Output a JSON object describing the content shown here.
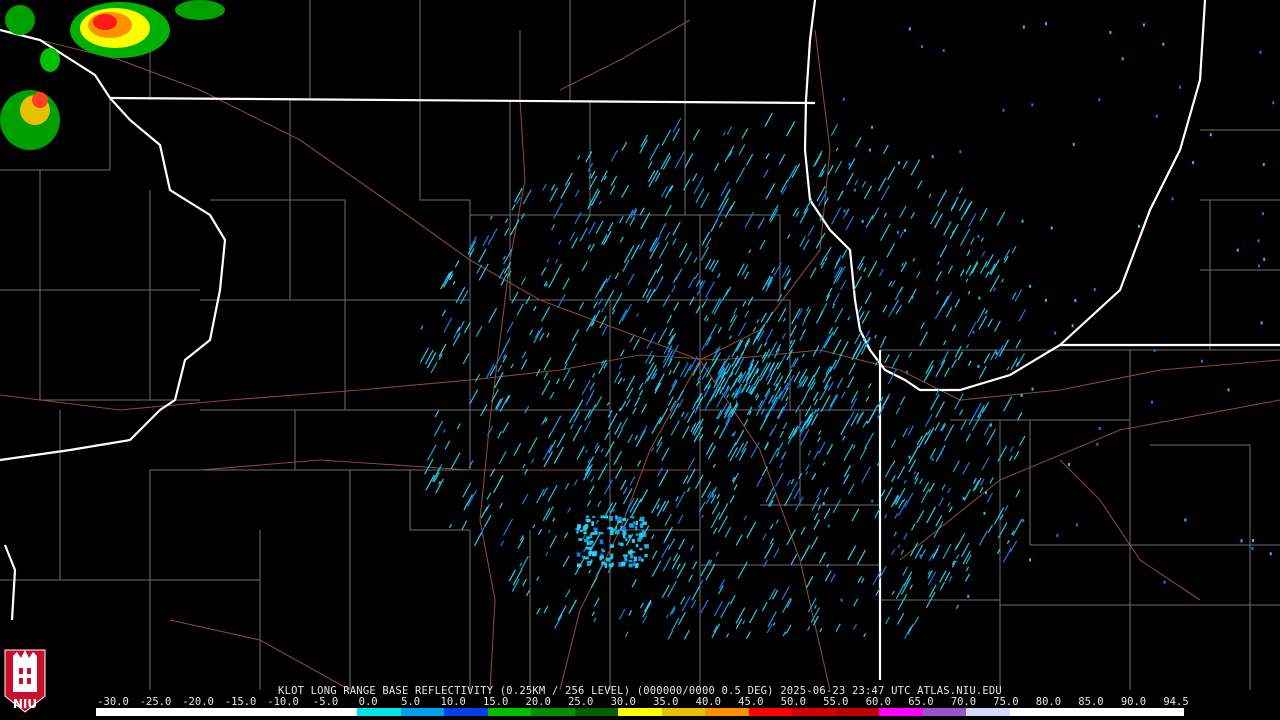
{
  "caption": "KLOT LONG RANGE BASE REFLECTIVITY (0.25KM / 256 LEVEL) (000000/0000 0.5 DEG) 2025-06-23 23:47 UTC  ATLAS.NIU.EDU",
  "scale": {
    "labels": [
      "-30.0",
      "-25.0",
      "-20.0",
      "-15.0",
      "-10.0",
      "-5.0",
      "0.0",
      "5.0",
      "10.0",
      "15.0",
      "20.0",
      "25.0",
      "30.0",
      "35.0",
      "40.0",
      "45.0",
      "50.0",
      "55.0",
      "60.0",
      "65.0",
      "70.0",
      "75.0",
      "80.0",
      "85.0",
      "90.0",
      "94.5"
    ],
    "colors": [
      "#ffffff",
      "#ffffff",
      "#ffffff",
      "#ffffff",
      "#ffffff",
      "#ffffff",
      "#00e6e6",
      "#00a0f0",
      "#0040f0",
      "#00c000",
      "#009000",
      "#006000",
      "#ffff00",
      "#e7c000",
      "#ff9000",
      "#ff0000",
      "#d60000",
      "#c00000",
      "#ff00ff",
      "#9955c9",
      "#d8d8ff",
      "#ffffff",
      "#ffffff",
      "#ffffff",
      "#ffffff"
    ]
  },
  "logo": {
    "text": "NIU",
    "color": "#c8102e"
  },
  "colors": {
    "state_border": "#ffffff",
    "county_line": "#7a7a7a",
    "road": "#8a4a2a",
    "echo_light": "#1ec8e6",
    "echo_blue": "#1a78e8"
  }
}
